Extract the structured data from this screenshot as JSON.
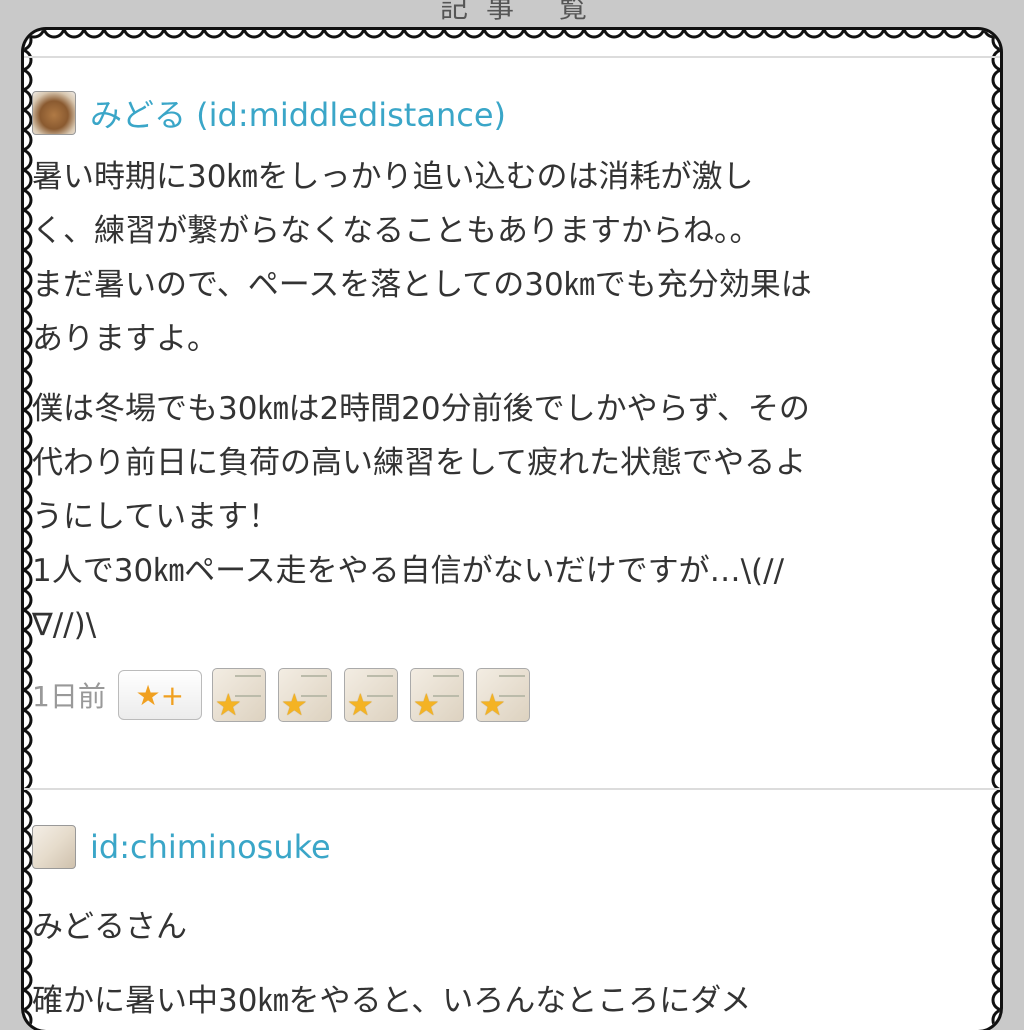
{
  "header_fragment": "記事 覧",
  "comments": [
    {
      "author": "みどる (id:middledistance)",
      "avatar_icon": "avatar-icon",
      "paragraphs": [
        "暑い時期に30㎞をしっかり追い込むのは消耗が激し\nく、練習が繋がらなくなることもありますからね。。\nまだ暑いので、ペースを落としての30㎞でも充分効果は\nありますよ。",
        "僕は冬場でも30㎞は2時間20分前後でしかやらず、その\n代わり前日に負荷の高い練習をして疲れた状態でやるよ\nうにしています！\n1人で30㎞ペース走をやる自信がないだけですが…\\(//\n∇//)\\"
      ],
      "time_ago": "1日前",
      "star_button": "★+",
      "stars_count": 5
    },
    {
      "author": "id:chiminosuke",
      "avatar_icon": "avatar-icon",
      "paragraphs": [
        "みどるさん",
        "確かに暑い中30㎞をやると、いろんなところにダメ"
      ]
    }
  ]
}
